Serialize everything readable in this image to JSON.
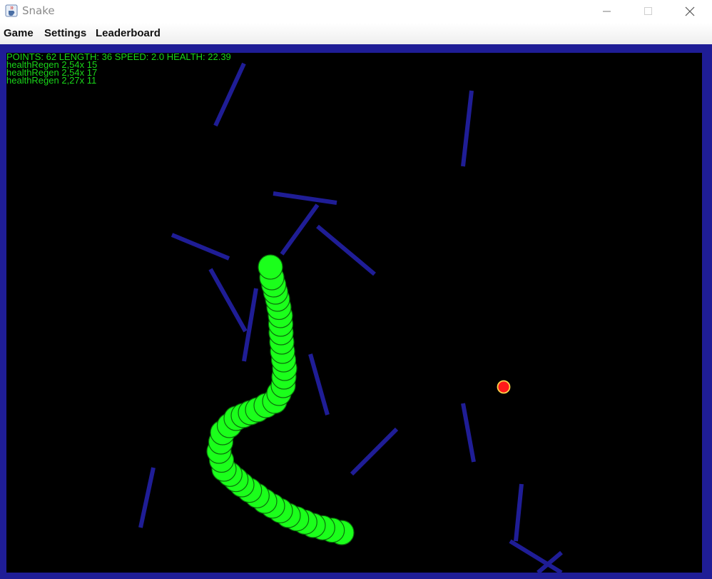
{
  "window": {
    "title": "Snake",
    "icon": "java-cup-icon",
    "controls": [
      "minimize-icon",
      "maximize-icon",
      "close-icon"
    ]
  },
  "menu": {
    "items": [
      "Game",
      "Settings",
      "Leaderboard"
    ]
  },
  "hud": {
    "status": "POINTS: 62 LENGTH: 36 SPEED: 2.0 HEALTH: 22.39",
    "effects": [
      "healthRegen 2,54x 15",
      "healthRegen 2,54x 17",
      "healthRegen 2,27x 11"
    ]
  },
  "colors": {
    "border": "#1f1d96",
    "board": "#000000",
    "snake": "#1bff1b",
    "snake_outline": "#0b6e0b",
    "food": "#ff1a1a",
    "food_outline": "#ffd54a",
    "hud_text": "#19d619"
  }
}
